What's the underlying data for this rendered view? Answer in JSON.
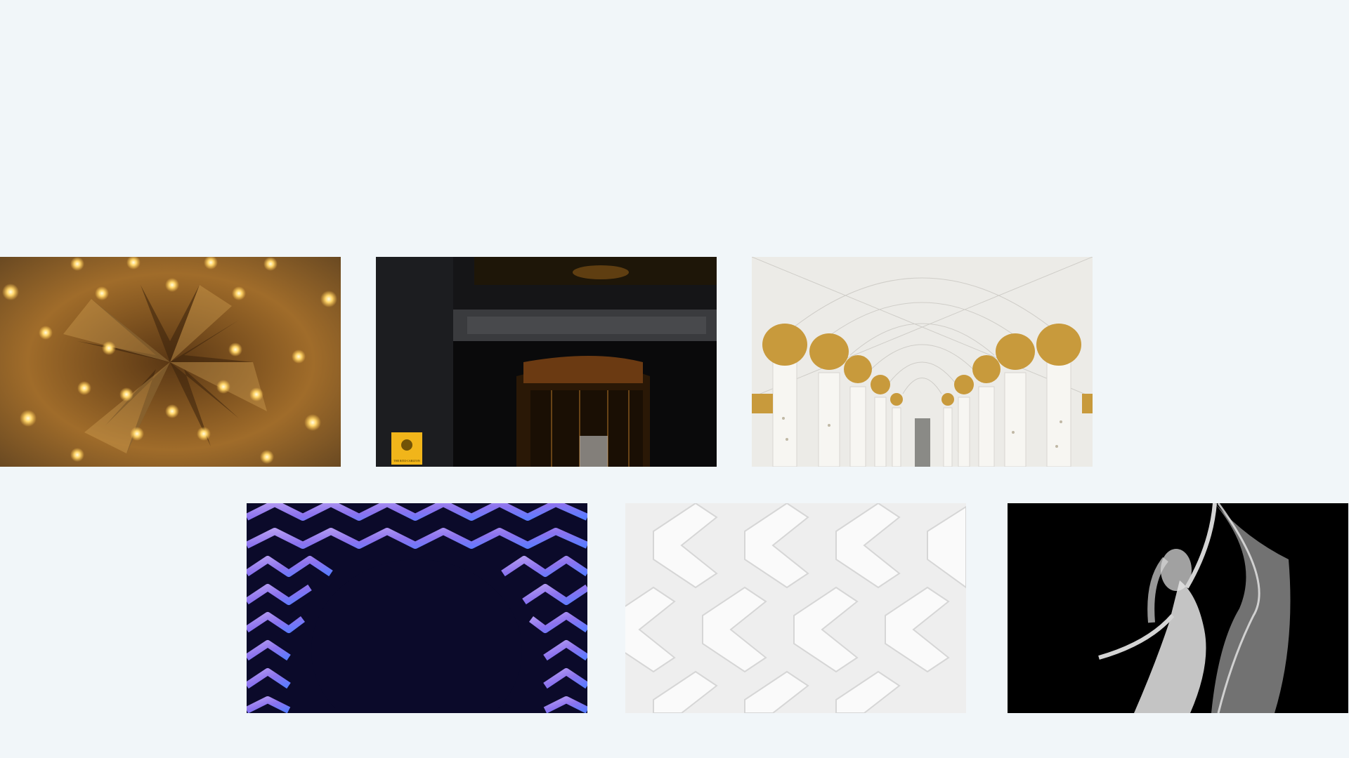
{
  "gallery": {
    "tiles": [
      {
        "id": "star-ceiling",
        "label": ""
      },
      {
        "id": "hotel-entrance",
        "label": "THE RITZ-CARLTON"
      },
      {
        "id": "mosque-arcade",
        "label": ""
      },
      {
        "id": "neon-lattice",
        "label": ""
      },
      {
        "id": "white-weave",
        "label": ""
      },
      {
        "id": "dancer",
        "label": ""
      }
    ]
  },
  "colors": {
    "background": "#f1f6f9",
    "gold": "#c89a3c",
    "lattice_purple": "#9b7cf0",
    "lattice_blue": "#5a7cff"
  }
}
